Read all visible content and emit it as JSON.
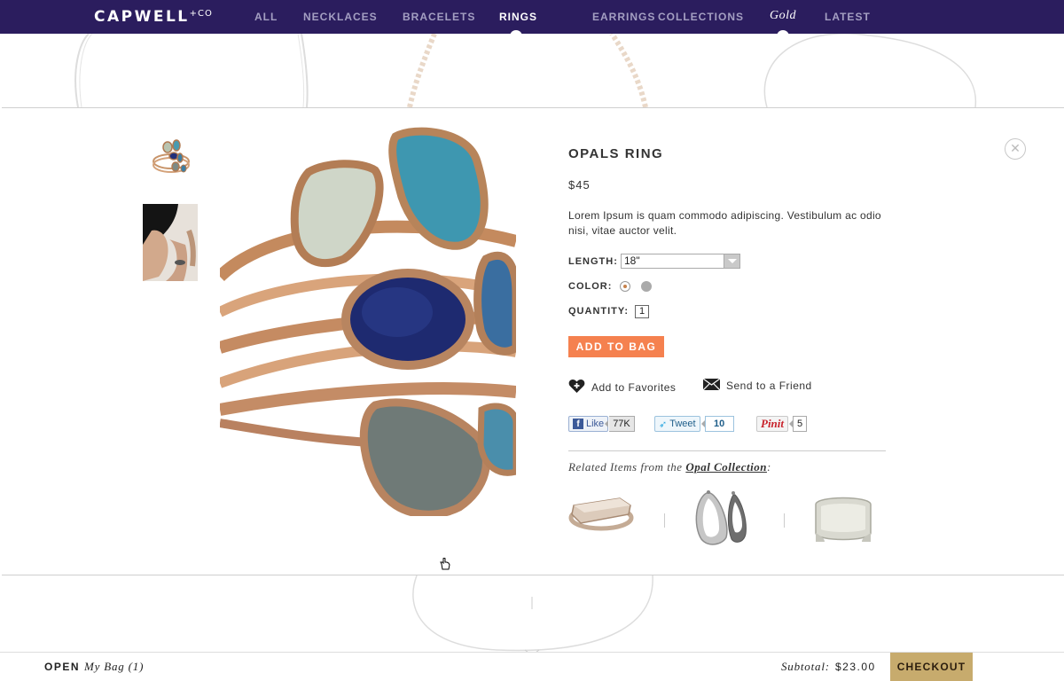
{
  "brand": {
    "name": "CAPWELL",
    "suffix": "+CO"
  },
  "nav": {
    "items": [
      {
        "label": "ALL"
      },
      {
        "label": "NECKLACES"
      },
      {
        "label": "BRACELETS"
      },
      {
        "label": "RINGS"
      },
      {
        "label": "EARRINGS"
      },
      {
        "label": "COLLECTIONS"
      },
      {
        "label": "Gold"
      },
      {
        "label": "LATEST"
      }
    ],
    "active": "RINGS"
  },
  "product": {
    "title": "OPALS RING",
    "price": "$45",
    "description": "Lorem Ipsum is quam commodo adipiscing. Vestibulum ac odio nisi, vitae auctor velit.",
    "length_label": "LENGTH:",
    "length_value": "18\"",
    "color_label": "COLOR:",
    "colors": [
      "#c6814a",
      "#aaaaaa"
    ],
    "quantity_label": "QUANTITY:",
    "quantity_value": "1",
    "add_to_bag": "ADD TO BAG",
    "add_favorites": "Add to Favorites",
    "send_friend": "Send to a Friend"
  },
  "social": {
    "like_label": "Like",
    "like_count": "77K",
    "tweet_label": "Tweet",
    "tweet_count": "10",
    "pin_label": "Pinit",
    "pin_count": "5"
  },
  "related": {
    "prefix": "Related Items from the ",
    "collection": "Opal Collection",
    "suffix": ":"
  },
  "bag": {
    "open_label": "OPEN",
    "bag_label": "My Bag (1)",
    "subtotal_label": "Subtotal:",
    "subtotal_value": "$23.00",
    "checkout_label": "CHECKOUT"
  },
  "colors": {
    "nav_bg": "#2b1d5e",
    "add_button": "#f5814f",
    "checkout": "#c7ab6d"
  }
}
